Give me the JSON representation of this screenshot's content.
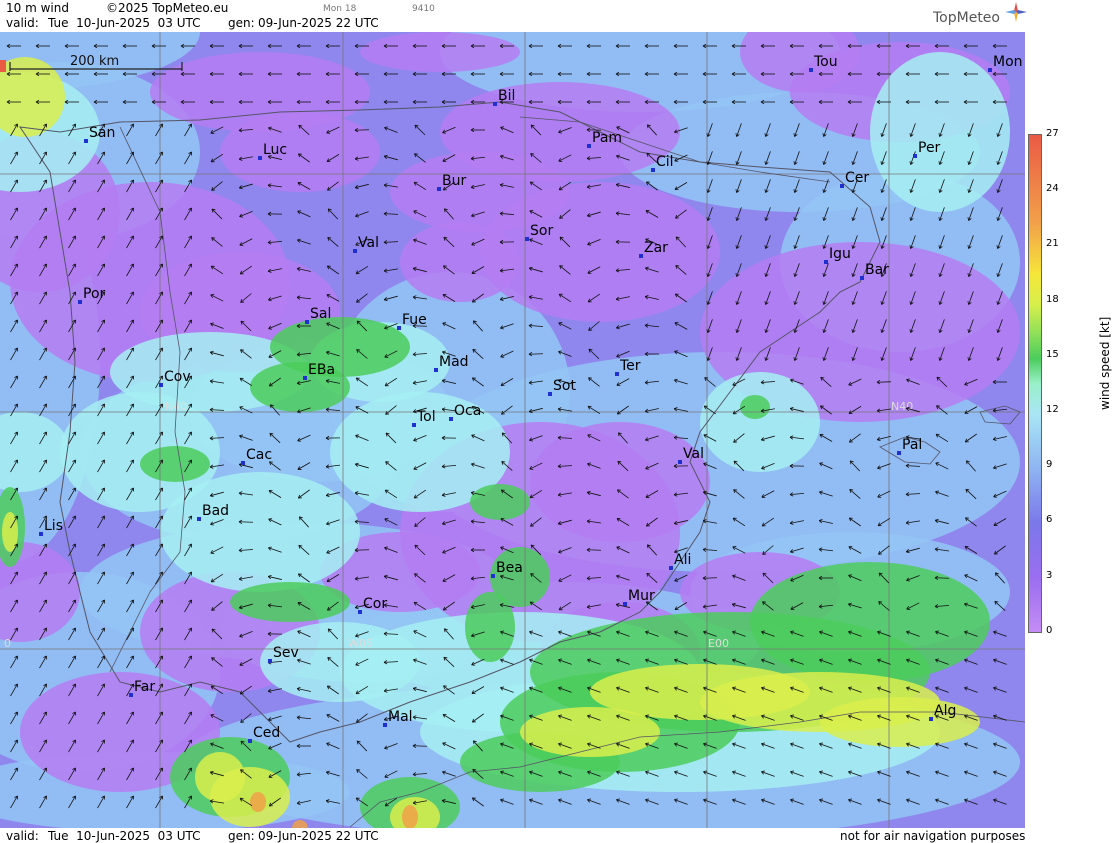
{
  "header": {
    "product": "10 m wind",
    "copyright": "©2025 TopMeteo.eu",
    "valid_label": "valid:",
    "valid_time": "Tue  10-Jun-2025  03 UTC",
    "gen_label": "gen:",
    "gen_time": "09-Jun-2025 22 UTC",
    "small_1": "Mon 18",
    "small_2": "9410",
    "logo_text": "TopMeteo"
  },
  "footer": {
    "valid_label": "valid:",
    "valid_time": "Tue  10-Jun-2025  03 UTC",
    "gen_label": "gen:",
    "gen_time": "09-Jun-2025 22 UTC",
    "disclaimer": "not for air navigation purposes"
  },
  "scale_bar": {
    "label": "200 km"
  },
  "grid_labels": [
    "N40",
    "N40",
    "W05",
    "E00",
    "0"
  ],
  "legend": {
    "title": "wind speed [kt]",
    "ticks": [
      "27",
      "24",
      "21",
      "18",
      "15",
      "12",
      "9",
      "6",
      "3",
      "0"
    ]
  },
  "cities": [
    {
      "name": "Tou"
    },
    {
      "name": "Mon"
    },
    {
      "name": "Bil"
    },
    {
      "name": "San"
    },
    {
      "name": "Pam"
    },
    {
      "name": "Luc"
    },
    {
      "name": "Cil"
    },
    {
      "name": "Per"
    },
    {
      "name": "Bur"
    },
    {
      "name": "Cer"
    },
    {
      "name": "Sor"
    },
    {
      "name": "Val"
    },
    {
      "name": "Zar"
    },
    {
      "name": "Igu"
    },
    {
      "name": "Bar"
    },
    {
      "name": "Por"
    },
    {
      "name": "Sal"
    },
    {
      "name": "Fue"
    },
    {
      "name": "Mad"
    },
    {
      "name": "Ter"
    },
    {
      "name": "EBa"
    },
    {
      "name": "Cov"
    },
    {
      "name": "Sot"
    },
    {
      "name": "Tol"
    },
    {
      "name": "Oca"
    },
    {
      "name": "Pal"
    },
    {
      "name": "Cac"
    },
    {
      "name": "Val"
    },
    {
      "name": "Bad"
    },
    {
      "name": "Lis"
    },
    {
      "name": "Bea"
    },
    {
      "name": "Ali"
    },
    {
      "name": "Mur"
    },
    {
      "name": "Cor"
    },
    {
      "name": "Sev"
    },
    {
      "name": "Far"
    },
    {
      "name": "Alg"
    },
    {
      "name": "Mal"
    },
    {
      "name": "Ced"
    }
  ],
  "colors": {
    "calm": "#b57cf2",
    "light": "#8f86ee",
    "moderate": "#93c6f5",
    "fresh": "#a6eef2",
    "strong": "#4ccc5c",
    "very_strong": "#d9ef4c",
    "gale": "#f0a048",
    "city_marker": "#1f2fd0"
  }
}
